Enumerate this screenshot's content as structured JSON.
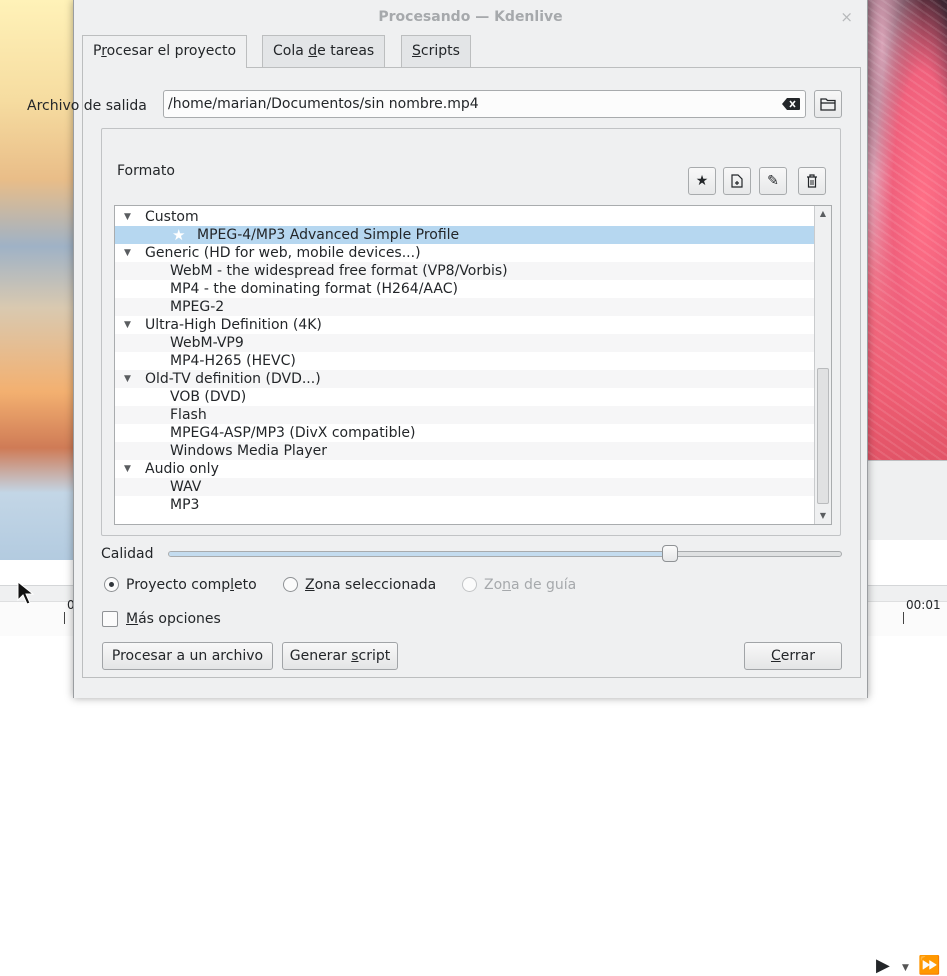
{
  "window": {
    "title": "Procesando — Kdenlive",
    "close_glyph": "×"
  },
  "tabs": [
    {
      "label": "Procesar el proyecto",
      "active": true
    },
    {
      "label": "Cola de tareas",
      "active": false
    },
    {
      "label": "Scripts",
      "active": false
    }
  ],
  "output": {
    "label": "Archivo de salida",
    "value": "/home/marian/Documentos/sin nombre.mp4",
    "clear_icon": "backspace-clear-icon",
    "folder_icon": "folder-open-icon"
  },
  "format": {
    "label": "Formato",
    "buttons": [
      {
        "name": "favorite-star",
        "glyph": "★"
      },
      {
        "name": "new-profile",
        "glyph": "new-document"
      },
      {
        "name": "edit-profile",
        "glyph": "✎"
      },
      {
        "name": "delete-profile",
        "glyph": "trash"
      }
    ],
    "rows": [
      {
        "kind": "group",
        "text": "Custom"
      },
      {
        "kind": "fav",
        "text": "MPEG-4/MP3 Advanced Simple Profile",
        "selected": true
      },
      {
        "kind": "group",
        "text": "Generic (HD for web, mobile devices...)"
      },
      {
        "kind": "item",
        "text": "WebM - the widespread free format (VP8/Vorbis)"
      },
      {
        "kind": "item",
        "text": "MP4 - the dominating format (H264/AAC)"
      },
      {
        "kind": "item",
        "text": "MPEG-2"
      },
      {
        "kind": "group",
        "text": "Ultra-High Definition (4K)"
      },
      {
        "kind": "item",
        "text": "WebM-VP9"
      },
      {
        "kind": "item",
        "text": "MP4-H265 (HEVC)"
      },
      {
        "kind": "group",
        "text": "Old-TV definition (DVD...)"
      },
      {
        "kind": "item",
        "text": "VOB (DVD)"
      },
      {
        "kind": "item",
        "text": "Flash"
      },
      {
        "kind": "item",
        "text": "MPEG4-ASP/MP3 (DivX compatible)"
      },
      {
        "kind": "item",
        "text": "Windows Media Player"
      },
      {
        "kind": "group",
        "text": "Audio only"
      },
      {
        "kind": "item",
        "text": "WAV"
      },
      {
        "kind": "item",
        "text": "MP3"
      }
    ]
  },
  "quality": {
    "label": "Calidad",
    "level": 0.74
  },
  "zone": {
    "options": [
      {
        "pre": "Proyecto comp",
        "u": "l",
        "post": "eto",
        "checked": true,
        "disabled": false
      },
      {
        "pre": "",
        "u": "Z",
        "post": "ona seleccionada",
        "checked": false,
        "disabled": false
      },
      {
        "pre": "Zo",
        "u": "n",
        "post": "a de guía",
        "checked": false,
        "disabled": true
      }
    ]
  },
  "more_options": {
    "pre": "",
    "u": "M",
    "post": "ás opciones",
    "checked": false
  },
  "buttons": {
    "render": "Procesar a un archivo",
    "script_pre": "Generar ",
    "script_u": "s",
    "script_post": "cript",
    "close_u": "C",
    "close_post": "errar"
  },
  "tab_mnemonics": {
    "t0_pre": "P",
    "t0_u": "r",
    "t0_post": "ocesar el proyecto",
    "t1_pre": "Cola ",
    "t1_u": "d",
    "t1_post": "e tareas",
    "t2_pre": "",
    "t2_u": "S",
    "t2_post": "cripts"
  },
  "background": {
    "timecode_right": "00:01",
    "timecode_left": "0"
  }
}
